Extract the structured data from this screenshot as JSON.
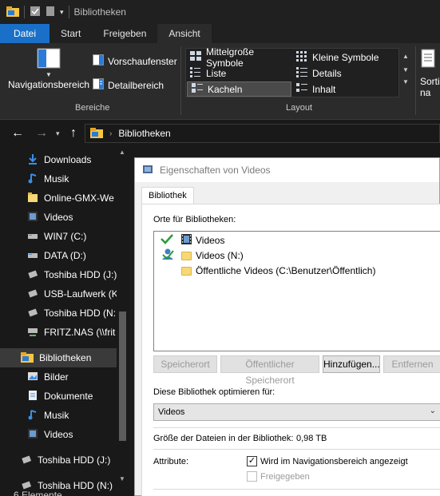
{
  "window": {
    "title": "Bibliotheken"
  },
  "ribbon": {
    "tabs": [
      "Datei",
      "Start",
      "Freigeben",
      "Ansicht"
    ],
    "active_tab": "Ansicht",
    "bereiche": {
      "group_label": "Bereiche",
      "nav_pane": "Navigationsbereich",
      "preview_pane": "Vorschaufenster",
      "details_pane": "Detailbereich"
    },
    "layout": {
      "group_label": "Layout",
      "items": [
        "Mittelgroße Symbole",
        "Kleine Symbole",
        "Liste",
        "Details",
        "Kacheln",
        "Inhalt"
      ],
      "selected": "Kacheln"
    },
    "sort": {
      "label_line1": "Sorti",
      "label_line2": "na"
    }
  },
  "address": {
    "path": "Bibliotheken"
  },
  "sidebar": {
    "items": [
      {
        "label": "Downloads",
        "icon": "download-icon"
      },
      {
        "label": "Musik",
        "icon": "music-icon"
      },
      {
        "label": "Online-GMX-We",
        "icon": "folder-icon"
      },
      {
        "label": "Videos",
        "icon": "video-icon"
      },
      {
        "label": "WIN7 (C:)",
        "icon": "drive-icon"
      },
      {
        "label": "DATA (D:)",
        "icon": "drive-icon"
      },
      {
        "label": "Toshiba HDD (J:)",
        "icon": "usb-drive-icon"
      },
      {
        "label": "USB-Laufwerk (K",
        "icon": "usb-drive-icon"
      },
      {
        "label": "Toshiba HDD (N:",
        "icon": "usb-drive-icon"
      },
      {
        "label": "FRITZ.NAS (\\\\frit",
        "icon": "network-drive-icon"
      },
      {
        "label": "Bibliotheken",
        "icon": "library-icon",
        "selected": true
      },
      {
        "label": "Bilder",
        "icon": "pictures-icon"
      },
      {
        "label": "Dokumente",
        "icon": "documents-icon"
      },
      {
        "label": "Musik",
        "icon": "music-icon"
      },
      {
        "label": "Videos",
        "icon": "video-icon"
      },
      {
        "label": "Toshiba HDD (J:)",
        "icon": "usb-drive-icon"
      },
      {
        "label": "Toshiba HDD (N:)",
        "icon": "usb-drive-icon"
      }
    ]
  },
  "statusbar": {
    "text": "6 Elemente"
  },
  "dialog": {
    "title": "Eigenschaften von Videos",
    "tab": "Bibliothek",
    "locations_label": "Orte für Bibliotheken:",
    "locations": [
      {
        "label": "Videos",
        "status": "default-save-location"
      },
      {
        "label": "Videos (N:)",
        "status": "public-save-location"
      },
      {
        "label": "Öffentliche Videos (C:\\Benutzer\\Öffentlich)",
        "status": ""
      }
    ],
    "buttons": {
      "save_location": "Speicherort",
      "public_save_location": "Öffentlicher Speicherort",
      "add": "Hinzufügen...",
      "remove": "Entfernen"
    },
    "optimize_label": "Diese Bibliothek optimieren für:",
    "optimize_value": "Videos",
    "size_label": "Größe der Dateien in der Bibliothek:",
    "size_value": "0,98 TB",
    "attributes_label": "Attribute:",
    "attr_nav": "Wird im Navigationsbereich angezeigt",
    "attr_nav_checked": true,
    "attr_shared": "Freigegeben",
    "attr_shared_checked": false
  }
}
